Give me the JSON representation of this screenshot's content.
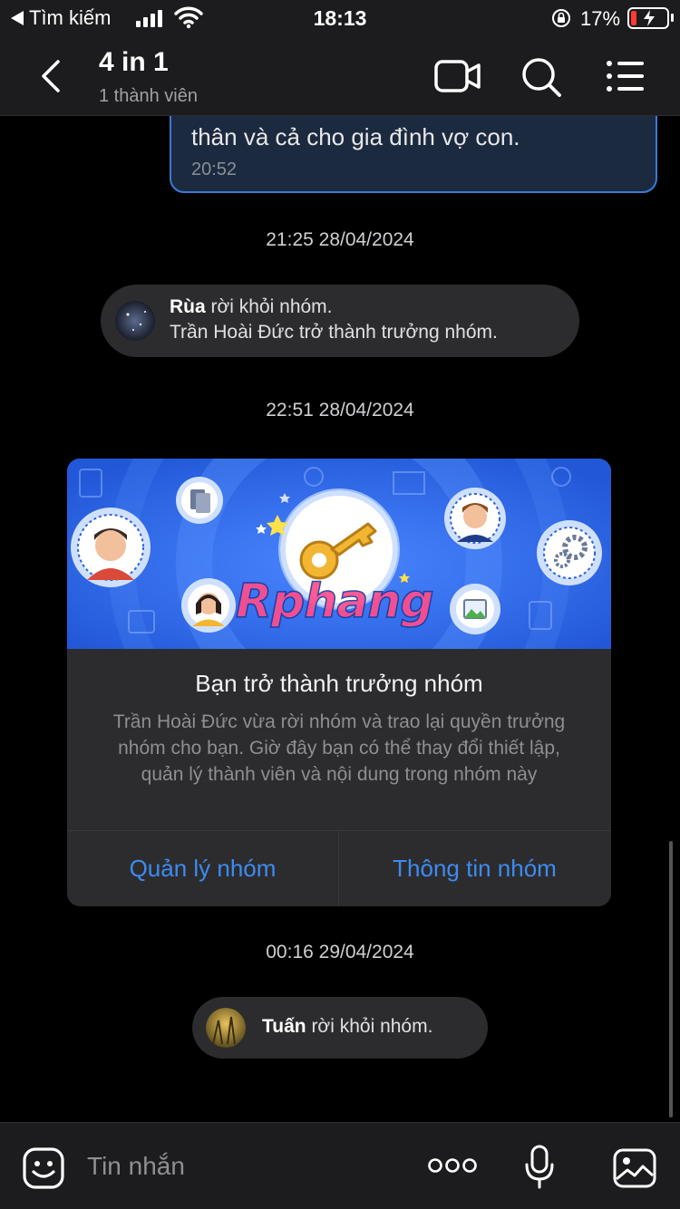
{
  "status_bar": {
    "back_app": "Tìm kiếm",
    "time": "18:13",
    "battery_pct": "17%",
    "battery_level": 0.17
  },
  "header": {
    "title": "4 in 1",
    "subtitle": "1 thành viên"
  },
  "messages": {
    "outgoing": {
      "text": "thân và cả cho gia đình vợ con.",
      "time": "20:52"
    },
    "stamp1": "21:25 28/04/2024",
    "event1": {
      "line1_name": "Rùa",
      "line1_rest": " rời khỏi nhóm.",
      "line2": "Trần Hoài Đức trở thành trưởng nhóm."
    },
    "stamp2": "22:51 28/04/2024",
    "card": {
      "brand": "Rphang",
      "title": "Bạn trở thành trưởng nhóm",
      "description": "Trần Hoài Đức vừa rời nhóm và trao lại quyền trưởng nhóm cho bạn. Giờ đây bạn có thể thay đổi thiết lập, quản lý thành viên và nội dung trong nhóm này",
      "btn_manage": "Quản lý nhóm",
      "btn_info": "Thông tin nhóm"
    },
    "stamp3": "00:16 29/04/2024",
    "event2": {
      "name": "Tuấn",
      "rest": " rời khỏi nhóm."
    }
  },
  "composer": {
    "placeholder": "Tin nhắn"
  },
  "colors": {
    "accent": "#3d8bf2",
    "banner": "#2f6be8",
    "outgoing_border": "#3a7bd5",
    "battery_low": "#ff3b30"
  }
}
